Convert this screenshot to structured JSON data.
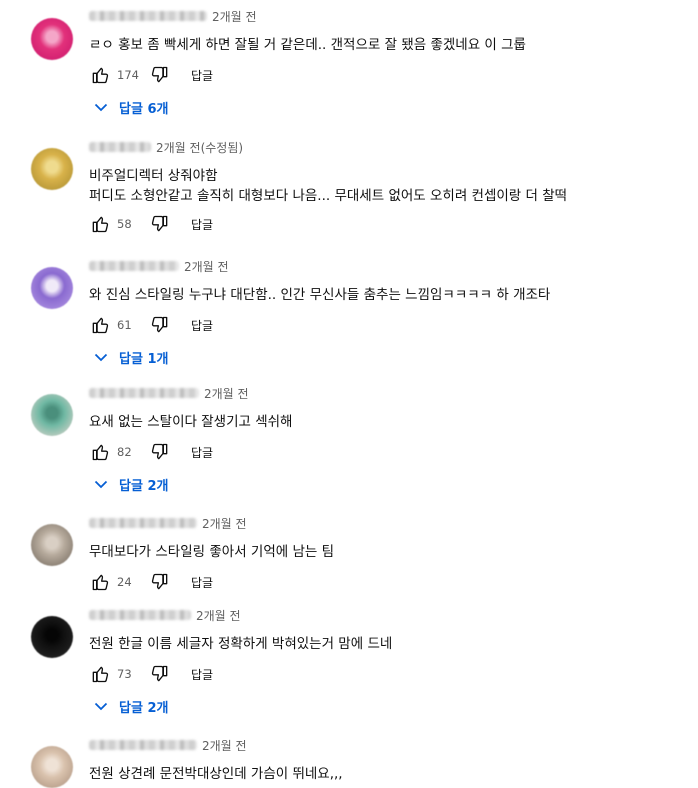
{
  "comments": [
    {
      "name_width": 118,
      "time": "2개월 전",
      "text": "ㄹㅇ 홍보 좀 빡세게 하면 잘될 거 같은데.. 갠적으로 잘 됐음 좋겠네요 이 그룹",
      "likes": "174",
      "reply_label": "답글",
      "replies_label": "답글 6개",
      "avatar_colors": [
        "#e2317b",
        "#c8156a",
        "#f4a6c8"
      ]
    },
    {
      "name_width": 62,
      "time": "2개월 전(수정됨)",
      "text": "비주얼디렉터 상줘야함",
      "text2": "퍼디도 소형안같고 솔직히 대형보다 나음... 무대세트 없어도 오히려 컨셉이랑 더 찰떡",
      "likes": "58",
      "reply_label": "답글",
      "avatar_colors": [
        "#d8b24a",
        "#a68a2e",
        "#efdb8e"
      ]
    },
    {
      "name_width": 90,
      "time": "2개월 전",
      "text": "와 진심 스타일링 누구냐 대단함.. 인간 무신사들 춤추는 느낌임ㅋㅋㅋㅋ 하 개조타",
      "likes": "61",
      "reply_label": "답글",
      "replies_label": "답글 1개",
      "avatar_colors": [
        "#8a6ad0",
        "#b59ae6",
        "#f0eaf8"
      ]
    },
    {
      "name_width": 110,
      "time": "2개월 전",
      "text": "요새 없는 스탈이다 잘생기고 섹쉬해",
      "likes": "82",
      "reply_label": "답글",
      "replies_label": "답글 2개",
      "avatar_colors": [
        "#6fb8a3",
        "#e7d7d0",
        "#4a8f7c"
      ]
    },
    {
      "name_width": 108,
      "time": "2개월 전",
      "text": "무대보다가 스타일링 좋아서 기억에 남는 팀",
      "likes": "24",
      "reply_label": "답글",
      "avatar_colors": [
        "#b6aa9c",
        "#6f655a",
        "#d9cfc4"
      ]
    },
    {
      "name_width": 102,
      "time": "2개월 전",
      "text": "전원 한글 이름 세글자 정확하게 박혀있는거 맘에 드네",
      "likes": "73",
      "reply_label": "답글",
      "replies_label": "답글 2개",
      "avatar_colors": [
        "#111111",
        "#2a2a2a",
        "#050505"
      ]
    },
    {
      "name_width": 108,
      "time": "2개월 전",
      "text": "전원 상견례 문전박대상인데 가슴이 뛰네요,,,",
      "avatar_colors": [
        "#d9c2ad",
        "#a88e7a",
        "#efe2d6"
      ]
    }
  ]
}
